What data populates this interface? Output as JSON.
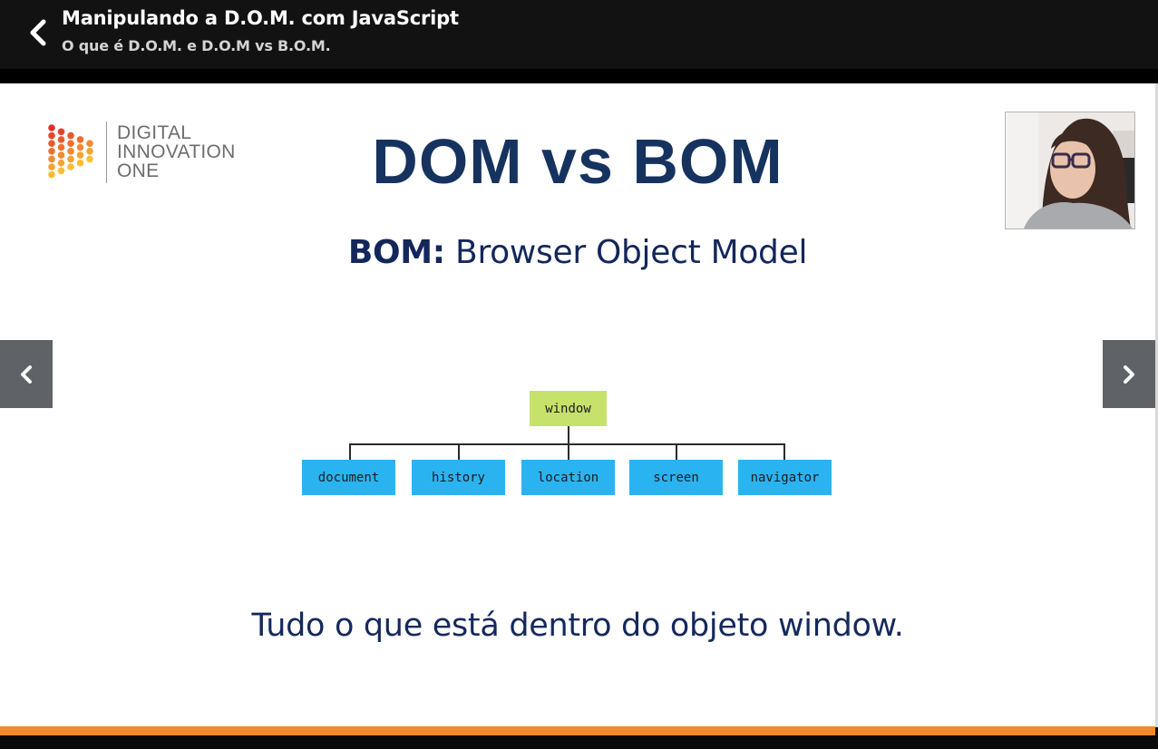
{
  "header": {
    "course_title": "Manipulando a D.O.M. com JavaScript",
    "lesson_title": "O que é D.O.M. e D.O.M vs B.O.M."
  },
  "slide": {
    "logo_lines": [
      "DIGITAL",
      "INNOVATION",
      "ONE"
    ],
    "heading": "DOM vs BOM",
    "subheading_strong": "BOM:",
    "subheading_rest": " Browser Object Model",
    "diagram": {
      "root": "window",
      "children": [
        "document",
        "history",
        "location",
        "screen",
        "navigator"
      ],
      "root_color": "#c6e26a",
      "child_color": "#2ab3f1"
    },
    "caption": "Tudo o que está dentro do objeto window."
  },
  "colors": {
    "heading": "#16335f",
    "progress": "#f08a2a",
    "nav_button": "#5f6367"
  },
  "icons": {
    "back": "chevron-left-icon",
    "prev": "chevron-left-icon",
    "next": "chevron-right-icon"
  }
}
